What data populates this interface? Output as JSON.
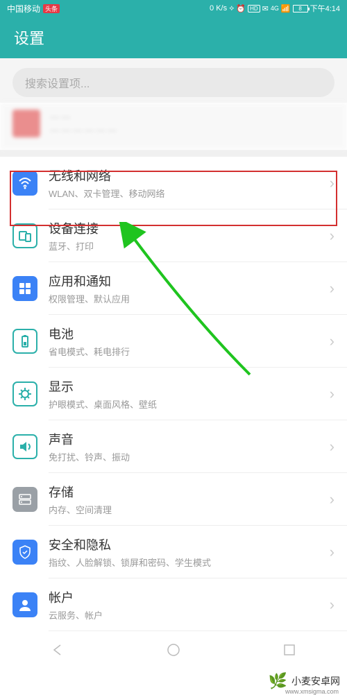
{
  "status": {
    "carrier": "中国移动",
    "badge": "头条",
    "speed": "0 K/s",
    "hd": "HD",
    "signal_gen": "4G",
    "battery": "8",
    "time": "下午4:14"
  },
  "title": "设置",
  "search": {
    "placeholder": "搜索设置项..."
  },
  "items": [
    {
      "title": "无线和网络",
      "sub": "WLAN、双卡管理、移动网络",
      "icon": "wifi",
      "color": "ic-blue"
    },
    {
      "title": "设备连接",
      "sub": "蓝牙、打印",
      "icon": "device",
      "color": "ic-teal"
    },
    {
      "title": "应用和通知",
      "sub": "权限管理、默认应用",
      "icon": "apps",
      "color": "ic-blue"
    },
    {
      "title": "电池",
      "sub": "省电模式、耗电排行",
      "icon": "battery",
      "color": "ic-teal"
    },
    {
      "title": "显示",
      "sub": "护眼模式、桌面风格、壁纸",
      "icon": "display",
      "color": "ic-teal"
    },
    {
      "title": "声音",
      "sub": "免打扰、铃声、振动",
      "icon": "sound",
      "color": "ic-teal"
    },
    {
      "title": "存储",
      "sub": "内存、空间清理",
      "icon": "storage",
      "color": "ic-gray"
    },
    {
      "title": "安全和隐私",
      "sub": "指纹、人脸解锁、锁屏和密码、学生模式",
      "icon": "security",
      "color": "ic-blue"
    },
    {
      "title": "帐户",
      "sub": "云服务、帐户",
      "icon": "account",
      "color": "ic-blue"
    }
  ],
  "watermark": {
    "text": "小麦安卓网",
    "url": "www.xmsigma.com"
  }
}
